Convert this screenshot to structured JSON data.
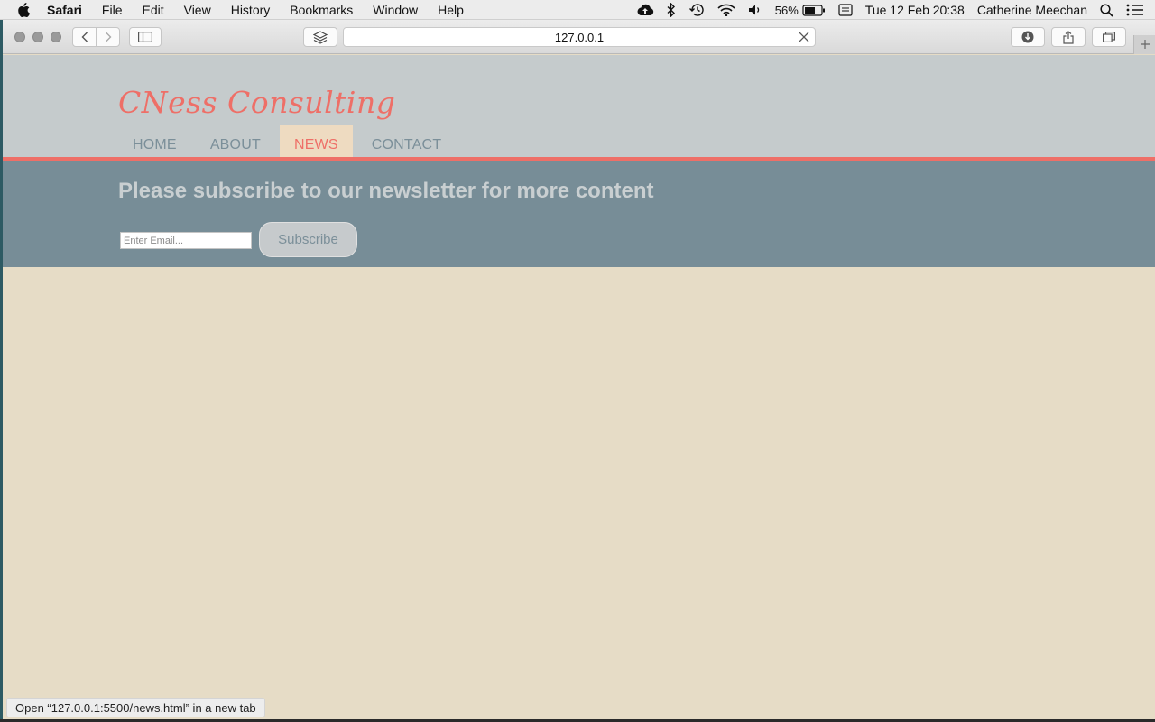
{
  "menubar": {
    "app_name": "Safari",
    "items": [
      "File",
      "Edit",
      "View",
      "History",
      "Bookmarks",
      "Window",
      "Help"
    ],
    "battery": "56%",
    "datetime": "Tue 12 Feb  20:38",
    "user": "Catherine Meechan"
  },
  "browser": {
    "url": "127.0.0.1",
    "status_text": "Open “127.0.0.1:5500/news.html” in a new tab"
  },
  "site": {
    "logo": "CNess Consulting",
    "nav": [
      {
        "label": "HOME"
      },
      {
        "label": "ABOUT"
      },
      {
        "label": "NEWS"
      },
      {
        "label": "CONTACT"
      }
    ],
    "subscribe": {
      "title": "Please subscribe to our newsletter for more content",
      "placeholder": "Enter Email...",
      "button": "Subscribe"
    }
  },
  "colors": {
    "accent": "#ee6f67",
    "header_bg": "#c5cbcc",
    "band_bg": "#778d97",
    "page_bg": "#e6dcc6",
    "nav_text": "#7b8f99"
  }
}
